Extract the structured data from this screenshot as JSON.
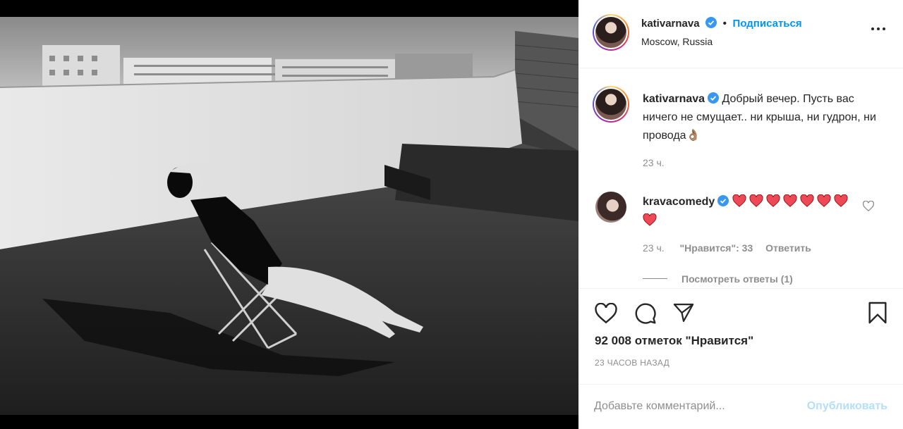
{
  "post": {
    "author": "kativarnava",
    "follow_label": "Подписаться",
    "location": "Moscow, Russia",
    "more_icon": "more-dots-icon"
  },
  "caption": {
    "author": "kativarnava",
    "text": "Добрый вечер. Пусть вас ничего не смущает.. ни крыша, ни гудрон, ни провода",
    "emoji": "👌🏽",
    "time": "23 ч."
  },
  "comment": {
    "author": "kravacomedy",
    "hearts": [
      "❤️",
      "❤️",
      "❤️",
      "❤️",
      "❤️",
      "❤️",
      "❤️",
      "❤️"
    ],
    "time": "23 ч.",
    "likes": "\"Нравится\": 33",
    "reply_label": "Ответить",
    "view_replies": "Посмотреть ответы (1)"
  },
  "actions": {
    "like_icon": "heart-icon",
    "comment_icon": "comment-icon",
    "share_icon": "share-icon",
    "save_icon": "bookmark-icon",
    "likes_text": "92 008 отметок \"Нравится\"",
    "posted_ago": "23 ЧАСОВ НАЗАД"
  },
  "comment_form": {
    "placeholder": "Добавьте комментарий...",
    "publish_label": "Опубликовать"
  },
  "colors": {
    "link_blue": "#0095f6",
    "publish_disabled": "#b2dffc",
    "heart_red": "#ed4956",
    "verified_blue": "#3897f0"
  }
}
